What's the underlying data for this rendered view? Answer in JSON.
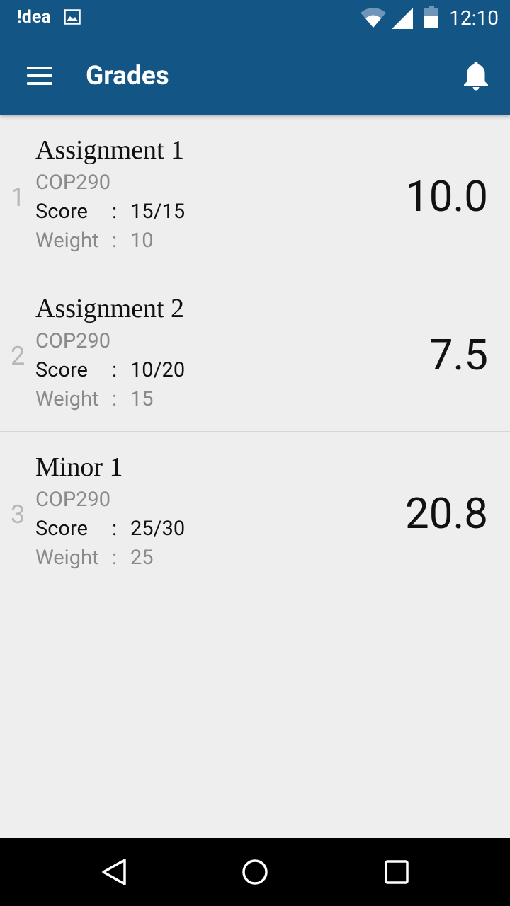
{
  "status_bar": {
    "carrier": "!dea",
    "time": "12:10",
    "icons": [
      "image-icon",
      "wifi-icon",
      "signal-icon",
      "battery-icon"
    ]
  },
  "app_bar": {
    "title": "Grades",
    "icons": [
      "menu-icon",
      "bell-icon"
    ]
  },
  "labels": {
    "score": "Score",
    "weight": "Weight",
    "separator": ":"
  },
  "grades": [
    {
      "index": "1",
      "name": "Assignment 1",
      "course": "COP290",
      "score": "15/15",
      "weight": "10",
      "value": "10.0"
    },
    {
      "index": "2",
      "name": "Assignment 2",
      "course": "COP290",
      "score": "10/20",
      "weight": "15",
      "value": "7.5"
    },
    {
      "index": "3",
      "name": "Minor 1",
      "course": "COP290",
      "score": "25/30",
      "weight": "25",
      "value": "20.8"
    }
  ],
  "nav_bar": {
    "icons": [
      "back-icon",
      "home-icon",
      "recent-apps-icon"
    ]
  },
  "colors": {
    "primary": "#135585",
    "background": "#eeeeee",
    "muted_text": "#8a8a8a",
    "index_text": "#b8b8b8"
  }
}
